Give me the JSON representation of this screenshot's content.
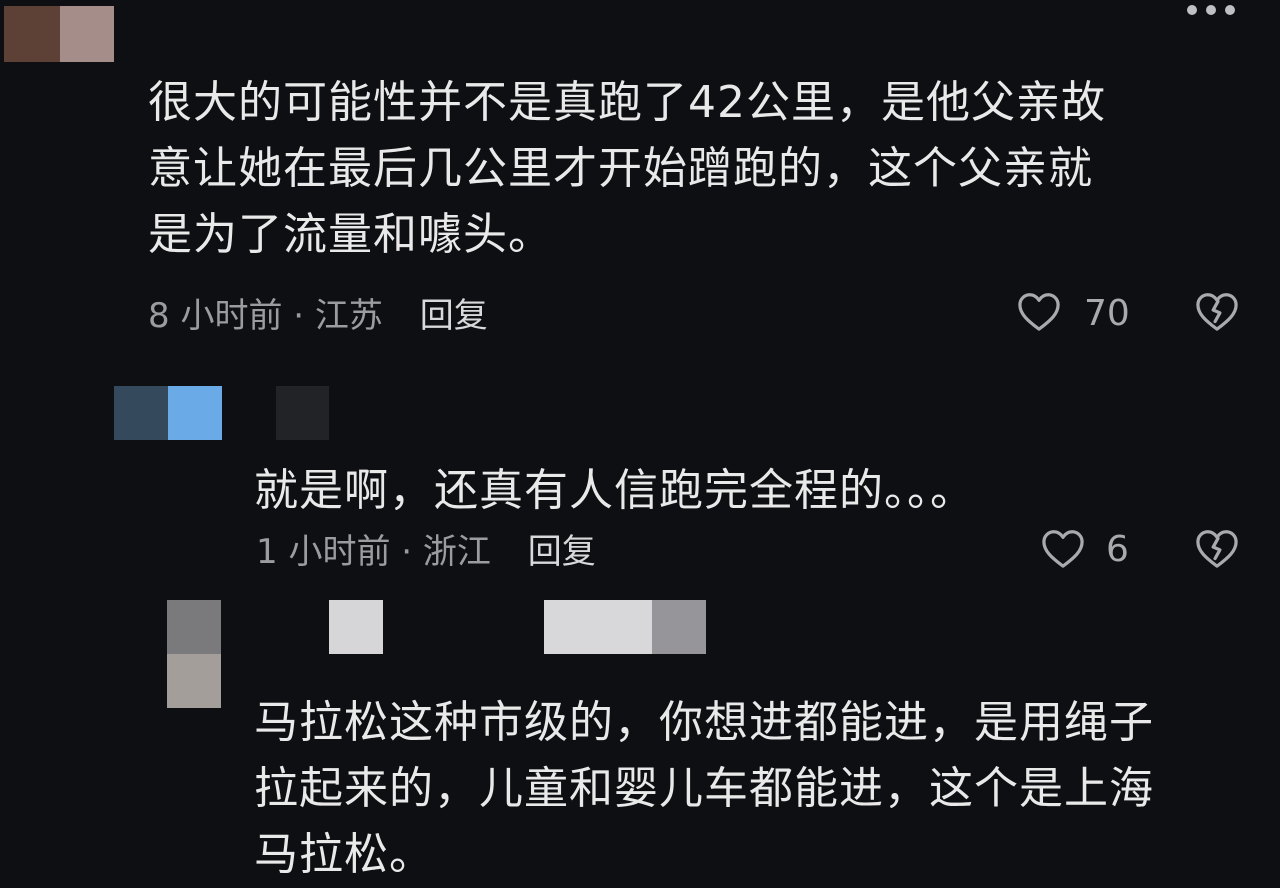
{
  "comments": [
    {
      "text_lines": [
        "很大的可能性并不是真跑了42公里，是他父亲故",
        "意让她在最后几公里才开始蹭跑的，这个父亲就",
        "是为了流量和噱头。"
      ],
      "time": "8 小时前",
      "separator": "·",
      "location": "江苏",
      "reply_label": "回复",
      "likes": "70"
    },
    {
      "text_lines": [
        "就是啊，还真有人信跑完全程的。。。"
      ],
      "time": "1 小时前",
      "separator": "·",
      "location": "浙江",
      "reply_label": "回复",
      "likes": "6"
    },
    {
      "text_lines": [
        "马拉松这种市级的，你想进都能进，是用绳子",
        "拉起来的，儿童和婴儿车都能进，这个是上海",
        "马拉松。"
      ]
    }
  ],
  "icons": {
    "like": "heart-outline-icon",
    "dislike": "broken-heart-icon",
    "more": "more-horizontal-icon"
  },
  "colors": {
    "background": "#0e0f12",
    "text": "#e9e9ea",
    "meta": "#9b9ca0"
  }
}
